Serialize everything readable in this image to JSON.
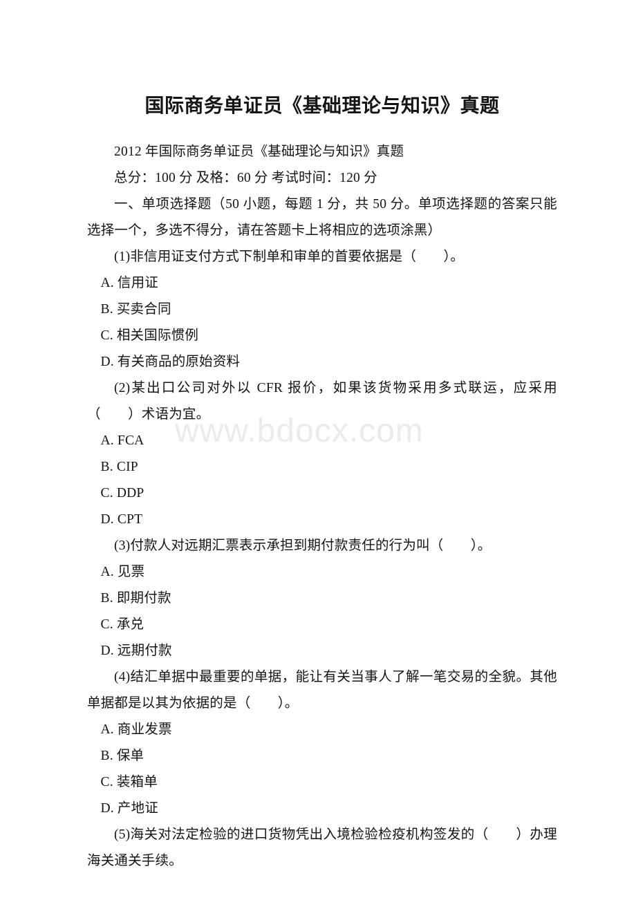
{
  "document": {
    "title": "国际商务单证员《基础理论与知识》真题",
    "watermark": "www.bdocx.com",
    "subtitle": "2012 年国际商务单证员《基础理论与知识》真题",
    "scoring_line": "总分：100 分 及格：60 分 考试时间：120 分",
    "section_instruction": "一、单项选择题（50 小题，每题 1 分，共 50 分。单项选择题的答案只能选择一个，多选不得分，请在答题卡上将相应的选项涂黑）"
  },
  "questions": [
    {
      "stem": "(1)非信用证支付方式下制单和审单的首要依据是（　　）。",
      "options": [
        "A. 信用证",
        "B. 买卖合同",
        "C. 相关国际惯例",
        "D. 有关商品的原始资料"
      ]
    },
    {
      "stem": "(2)某出口公司对外以 CFR 报价，如果该货物采用多式联运，应采用（　　）术语为宜。",
      "options": [
        "A. FCA",
        "B. CIP",
        "C. DDP",
        "D. CPT"
      ]
    },
    {
      "stem": "(3)付款人对远期汇票表示承担到期付款责任的行为叫（　　）。",
      "options": [
        "A. 见票",
        "B. 即期付款",
        "C. 承兑",
        "D. 远期付款"
      ]
    },
    {
      "stem": "(4)结汇单据中最重要的单据，能让有关当事人了解一笔交易的全貌。其他单据都是以其为依据的是（　　）。",
      "options": [
        "A. 商业发票",
        "B. 保单",
        "C. 装箱单",
        "D. 产地证"
      ]
    },
    {
      "stem": "(5)海关对法定检验的进口货物凭出入境检验检疫机构签发的（　　）办理海关通关手续。",
      "options": []
    }
  ]
}
